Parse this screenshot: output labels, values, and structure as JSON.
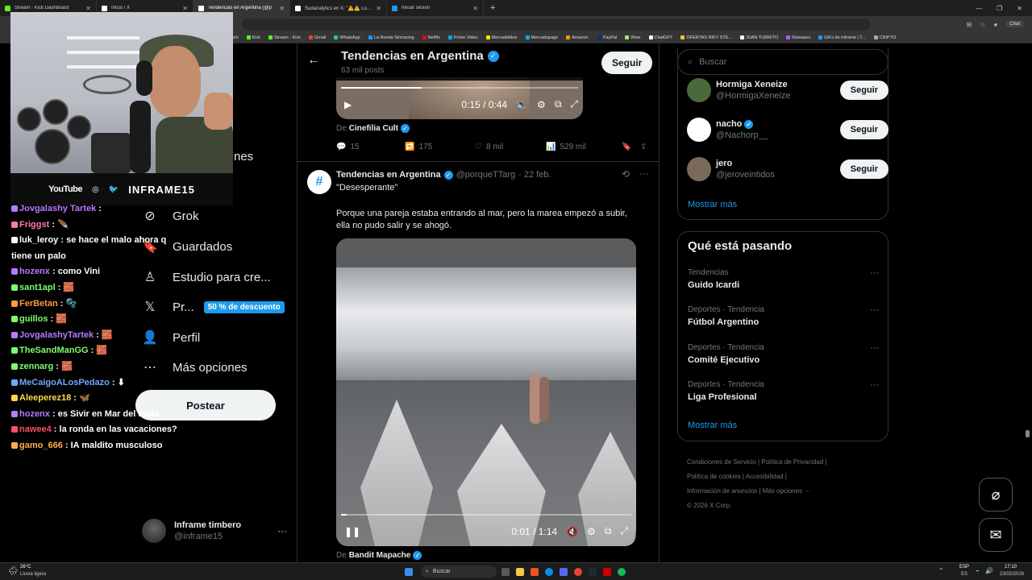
{
  "browser": {
    "tabs": [
      {
        "label": "Stream - Kick Dashboard",
        "color": "#53fc18",
        "active": false
      },
      {
        "label": "Inicio / X",
        "color": "#ffffff",
        "active": false
      },
      {
        "label": "Tendencias en Argentina (@p",
        "color": "#ffffff",
        "active": true
      },
      {
        "label": "Sudanalytics en X: \"⚠️⚠️ Los club",
        "color": "#ffffff",
        "active": false
      },
      {
        "label": "Iniciar sesión",
        "color": "#1d9bf0",
        "active": false
      }
    ],
    "chat_button": "Chat",
    "bookmarks": [
      {
        "label": "itch",
        "color": "#9146ff"
      },
      {
        "label": "Kick",
        "color": "#53fc18"
      },
      {
        "label": "Stream - Kick",
        "color": "#53fc18"
      },
      {
        "label": "Gmail",
        "color": "#ea4335"
      },
      {
        "label": "WhatsApp",
        "color": "#25d366"
      },
      {
        "label": "La Ronda Simracing",
        "color": "#1d9bf0"
      },
      {
        "label": "Netflix",
        "color": "#e50914"
      },
      {
        "label": "Prime Video",
        "color": "#00a8e1"
      },
      {
        "label": "Mercadolibre",
        "color": "#ffe600"
      },
      {
        "label": "Mercadopago",
        "color": "#00b1ea"
      },
      {
        "label": "Amazon.",
        "color": "#ff9900"
      },
      {
        "label": "PayPal",
        "color": "#003087"
      },
      {
        "label": "Wise",
        "color": "#9fe870"
      },
      {
        "label": "ChatGPT",
        "color": "#ffffff"
      },
      {
        "label": "OFERTAS RIKY STE...",
        "color": "#f5c518"
      },
      {
        "label": "JUAN TURRITO",
        "color": "#ffffff"
      },
      {
        "label": "Releases",
        "color": "#b05cff"
      },
      {
        "label": "GIFs de Inframe | T...",
        "color": "#1d9bf0"
      },
      {
        "label": "CRIPTO",
        "color": "#aaaaaa"
      }
    ]
  },
  "webcam": {
    "platform": "YouTube",
    "brand": "INFRAME15"
  },
  "chat": [
    {
      "user": "Jovgalashy Tartek",
      "msg": "",
      "color": "#b57bff"
    },
    {
      "user": "Friggst",
      "msg": " 🪶",
      "color": "#ff7aa8"
    },
    {
      "user": "luk_leroy",
      "msg": " se hace el malo ahora q",
      "color": "#ffffff",
      "msg2": "tiene un palo"
    },
    {
      "user": "hozenx",
      "msg": " como Vini",
      "color": "#b57bff"
    },
    {
      "user": "sant1apl",
      "msg": " 🧱",
      "color": "#7cff6b"
    },
    {
      "user": "FerBetan",
      "msg": " 🫧",
      "color": "#ff9a3c"
    },
    {
      "user": "guillos",
      "msg": " 🧱",
      "color": "#7cff6b"
    },
    {
      "user": "JovgalashyTartek",
      "msg": " 🧱",
      "color": "#b57bff"
    },
    {
      "user": "TheSandManGG",
      "msg": " 🧱",
      "color": "#7cff6b"
    },
    {
      "user": "zennarg",
      "msg": " 🧱",
      "color": "#7cff6b"
    },
    {
      "user": "MeCaigoALosPedazo",
      "msg": " ⬇",
      "color": "#6fa8ff"
    },
    {
      "user": "Aleeperez18",
      "msg": " 🦋",
      "color": "#ffd84a"
    },
    {
      "user": "hozenx",
      "msg": " es Sivir en Mar del Plata",
      "color": "#b57bff"
    },
    {
      "user": "nawee4",
      "msg": " la ronda en las vacaciones?",
      "color": "#ff4f6b"
    },
    {
      "user": "gamo_666",
      "msg": " IA maldito musculoso",
      "color": "#ffb04a"
    }
  ],
  "nav": {
    "partial_label": "nes",
    "items": [
      {
        "label": "Grok",
        "icon": "grok-icon"
      },
      {
        "label": "Guardados",
        "icon": "bookmark-icon"
      },
      {
        "label": "Estudio para cre...",
        "icon": "studio-icon"
      },
      {
        "label": "Pr...",
        "icon": "x-logo-icon",
        "promo": "50 % de descuento"
      },
      {
        "label": "Perfil",
        "icon": "profile-icon"
      },
      {
        "label": "Más opciones",
        "icon": "more-options-icon"
      }
    ],
    "post_button": "Postear",
    "account": {
      "name": "Inframe timbero",
      "handle": "@inframe15"
    }
  },
  "main": {
    "header": {
      "title": "Tendencias en Argentina",
      "subtitle": "63 mil posts",
      "follow": "Seguir"
    },
    "post1": {
      "time": "0:15 / 0:44",
      "progress": 0.34,
      "source_prefix": "De",
      "source": "Cinefilia Cult",
      "replies": "15",
      "reposts": "175",
      "likes": "8 mil",
      "views": "529 mil"
    },
    "post2": {
      "author": "Tendencias en Argentina",
      "handle": "@porqueTTarg",
      "date": "· 22 feb.",
      "text1": "\"Desesperante\"",
      "text2": "Porque una pareja estaba entrando al mar, pero la marea empezó a subir, ella no pudo salir y se ahogó.",
      "time": "0:01 / 1:14",
      "progress": 0.02,
      "source_prefix": "De",
      "source": "Bandit Mapache"
    }
  },
  "right": {
    "search_placeholder": "Buscar",
    "suggestions": [
      {
        "name": "Hormiga Xeneize",
        "handle": "@HormigaXeneize",
        "verified": false,
        "follow": "Seguir"
      },
      {
        "name": "nacho",
        "handle": "@Nachorp__",
        "verified": true,
        "follow": "Seguir"
      },
      {
        "name": "jero",
        "handle": "@jeroveintidos",
        "verified": false,
        "follow": "Seguir"
      }
    ],
    "show_more": "Mostrar más",
    "trending_title": "Qué está pasando",
    "trends": [
      {
        "category": "Tendencias",
        "name": "Guido Icardi"
      },
      {
        "category": "Deportes · Tendencia",
        "name": "Fútbol Argentino"
      },
      {
        "category": "Deportes · Tendencia",
        "name": "Comité Ejecutivo"
      },
      {
        "category": "Deportes · Tendencia",
        "name": "Liga Profesional"
      }
    ],
    "show_more2": "Mostrar más",
    "footer": {
      "l1": "Condiciones de Servicio",
      "l2": "Política de Privacidad",
      "l3": "Política de cookies",
      "l4": "Accesibilidad",
      "l5": "Información de anuncios",
      "l6": "Más opciones ···",
      "copyright": "© 2026 X Corp."
    }
  },
  "taskbar": {
    "weather_temp": "26°C",
    "weather_desc": "Lluvia ligera",
    "search": "Buscar",
    "lang1": "ESP",
    "lang2": "ES",
    "time": "17:10",
    "date": "23/02/2026"
  }
}
